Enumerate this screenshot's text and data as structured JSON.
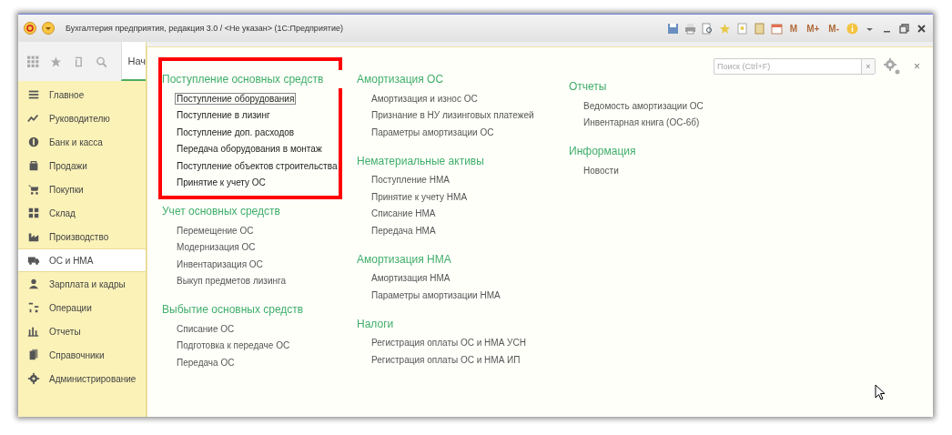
{
  "window": {
    "title": "Бухгалтерия предприятия, редакция 3.0 / <Не указан>  (1С:Предприятие)",
    "memory_buttons": [
      "M",
      "M+",
      "M-"
    ]
  },
  "sidebar": {
    "tab": "Нач",
    "items": [
      {
        "label": "Главное",
        "selected": false
      },
      {
        "label": "Руководителю",
        "selected": false
      },
      {
        "label": "Банк и касса",
        "selected": false
      },
      {
        "label": "Продажи",
        "selected": false
      },
      {
        "label": "Покупки",
        "selected": false
      },
      {
        "label": "Склад",
        "selected": false
      },
      {
        "label": "Производство",
        "selected": false
      },
      {
        "label": "ОС и НМА",
        "selected": true
      },
      {
        "label": "Зарплата и кадры",
        "selected": false
      },
      {
        "label": "Операции",
        "selected": false
      },
      {
        "label": "Отчеты",
        "selected": false
      },
      {
        "label": "Справочники",
        "selected": false
      },
      {
        "label": "Администрирование",
        "selected": false
      }
    ]
  },
  "panel": {
    "search": {
      "placeholder": "Поиск (Ctrl+F)",
      "clear": "×"
    },
    "close": "×",
    "columns": [
      {
        "groups": [
          {
            "title": "Поступление основных средств",
            "highlighted": true,
            "items": [
              {
                "label": "Поступление оборудования",
                "focused": true
              },
              {
                "label": "Поступление в лизинг",
                "focused": false
              },
              {
                "label": "Поступление доп. расходов",
                "focused": false
              },
              {
                "label": "Передача оборудования в монтаж",
                "focused": false
              },
              {
                "label": "Поступление объектов строительства",
                "focused": false
              },
              {
                "label": "Принятие к учету ОС",
                "focused": false
              }
            ]
          },
          {
            "title": "Учет основных средств",
            "highlighted": false,
            "items": [
              {
                "label": "Перемещение ОС",
                "focused": false
              },
              {
                "label": "Модернизация ОС",
                "focused": false
              },
              {
                "label": "Инвентаризация ОС",
                "focused": false
              },
              {
                "label": "Выкуп предметов лизинга",
                "focused": false
              }
            ]
          },
          {
            "title": "Выбытие основных средств",
            "highlighted": false,
            "items": [
              {
                "label": "Списание ОС",
                "focused": false
              },
              {
                "label": "Подготовка к передаче ОС",
                "focused": false
              },
              {
                "label": "Передача ОС",
                "focused": false
              }
            ]
          }
        ]
      },
      {
        "groups": [
          {
            "title": "Амортизация ОС",
            "highlighted": false,
            "items": [
              {
                "label": "Амортизация и износ ОС",
                "focused": false
              },
              {
                "label": "Признание в НУ лизинговых платежей",
                "focused": false
              },
              {
                "label": "Параметры амортизации ОС",
                "focused": false
              }
            ]
          },
          {
            "title": "Нематериальные активы",
            "highlighted": false,
            "items": [
              {
                "label": "Поступление НМА",
                "focused": false
              },
              {
                "label": "Принятие к учету НМА",
                "focused": false
              },
              {
                "label": "Списание НМА",
                "focused": false
              },
              {
                "label": "Передача НМА",
                "focused": false
              }
            ]
          },
          {
            "title": "Амортизация НМА",
            "highlighted": false,
            "items": [
              {
                "label": "Амортизация НМА",
                "focused": false
              },
              {
                "label": "Параметры амортизации НМА",
                "focused": false
              }
            ]
          },
          {
            "title": "Налоги",
            "highlighted": false,
            "items": [
              {
                "label": "Регистрация оплаты ОС и НМА УСН",
                "focused": false
              },
              {
                "label": "Регистрация оплаты ОС и НМА ИП",
                "focused": false
              }
            ]
          }
        ]
      },
      {
        "groups": [
          {
            "title": "Отчеты",
            "highlighted": false,
            "items": [
              {
                "label": "Ведомость амортизации ОС",
                "focused": false
              },
              {
                "label": "Инвентарная книга (ОС-6б)",
                "focused": false
              }
            ]
          },
          {
            "title": "Информация",
            "highlighted": false,
            "items": [
              {
                "label": "Новости",
                "focused": false
              }
            ]
          }
        ]
      }
    ]
  }
}
